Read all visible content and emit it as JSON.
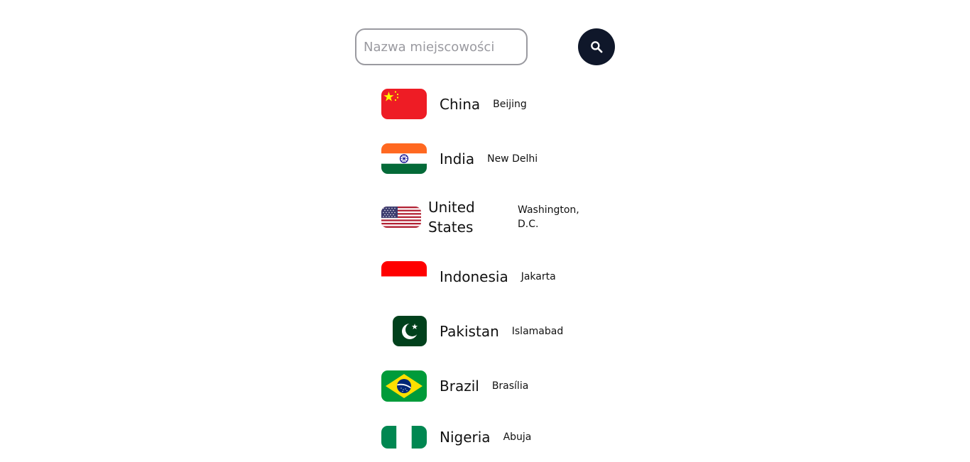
{
  "search": {
    "placeholder": "Nazwa miejscowości",
    "button_icon": "search-icon"
  },
  "colors": {
    "search_button_bg": "#0f172a",
    "input_border": "#9a9aa0"
  },
  "countries": [
    {
      "name": "China",
      "capital": "Beijing",
      "flag": "china-flag"
    },
    {
      "name": "India",
      "capital": "New Delhi",
      "flag": "india-flag"
    },
    {
      "name": "United States",
      "capital": "Washington, D.C.",
      "flag": "usa-flag"
    },
    {
      "name": "Indonesia",
      "capital": "Jakarta",
      "flag": "indonesia-flag"
    },
    {
      "name": "Pakistan",
      "capital": "Islamabad",
      "flag": "pakistan-flag"
    },
    {
      "name": "Brazil",
      "capital": "Brasília",
      "flag": "brazil-flag"
    },
    {
      "name": "Nigeria",
      "capital": "Abuja",
      "flag": "nigeria-flag"
    }
  ]
}
